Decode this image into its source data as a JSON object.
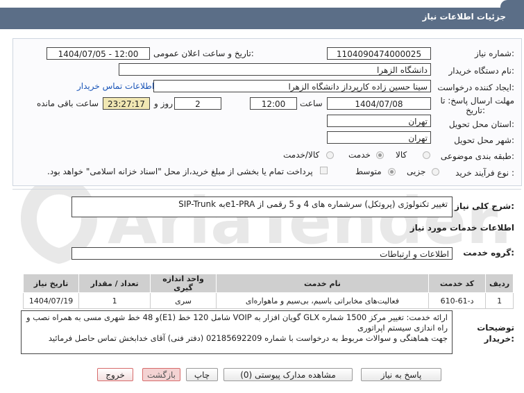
{
  "header": {
    "title": "جزئیات اطلاعات نیاز"
  },
  "watermark": {
    "text": "AriaTender.net"
  },
  "form": {
    "need_number": {
      "label": "شماره نیاز:",
      "value": "1104090474000025"
    },
    "announce_datetime": {
      "label": "تاریخ و ساعت اعلان عمومی:",
      "value": "1404/07/05 - 12:00"
    },
    "buyer_org": {
      "label": "نام دستگاه خریدار:",
      "value": "دانشگاه الزهرا"
    },
    "requester": {
      "label": "ایجاد کننده درخواست:",
      "value": "سینا حسین زاده کارپرداز دانشگاه الزهرا"
    },
    "buyer_contact_link": "اطلاعات تماس خریدار",
    "deadline": {
      "label_line1": "مهلت ارسال پاسخ: تا",
      "label_line2": "تاریخ:",
      "date": "1404/07/08",
      "time_label": "ساعت",
      "time": "12:00",
      "days": "2",
      "days_label": "روز و",
      "remaining": "23:27:17",
      "remaining_label": "ساعت باقی مانده"
    },
    "province": {
      "label": "استان محل تحویل:",
      "value": "تهران"
    },
    "city": {
      "label": "شهر محل تحویل:",
      "value": "تهران"
    },
    "category": {
      "label": "طبقه بندی موضوعی:",
      "options": [
        "کالا",
        "خدمت",
        "کالا/خدمت"
      ],
      "selected": "خدمت"
    },
    "purchase_type": {
      "label": "نوع فرآیند خرید :",
      "options": [
        "جزیی",
        "متوسط"
      ],
      "selected": "متوسط",
      "payment_note": "پرداخت تمام یا بخشی از مبلغ خرید،از محل \"اسناد خزانه اسلامی\" خواهد بود."
    }
  },
  "general_description": {
    "label": "شرح کلی نیاز:",
    "value": "تغییر تکنولوژی (پروتکل) سرشماره های 4 و 5 رقمی از e1-PRAبه SIP-Trunk"
  },
  "services_section": {
    "title": "اطلاعات خدمات مورد نیاز"
  },
  "service_group": {
    "label": "گروه خدمت:",
    "value": "اطلاعات و ارتباطات"
  },
  "table": {
    "headers": [
      "ردیف",
      "کد خدمت",
      "نام خدمت",
      "واحد اندازه گیری",
      "تعداد / مقدار",
      "تاریخ نیاز"
    ],
    "rows": [
      [
        "1",
        "د-61-610",
        "فعالیت‌های مخابراتی باسیم، بی‌سیم و ماهواره‌ای",
        "سری",
        "1",
        "1404/07/19"
      ]
    ]
  },
  "buyer_notes": {
    "label_line1": "توضیحات",
    "label_line2": "خریدار:",
    "lines": [
      "ارائه خدمت: تغییر مرکز 1500 شماره GLX گویان افزار به VOIP شامل 120 خط (E1)و 48 خط شهری مسی به همراه نصب و",
      "راه اندازی سیستم اپراتوری",
      "جهت هماهنگی و سوالات مربوط به درخواست با شماره 02185692209 (دفتر فنی) آقای خدابخش تماس حاصل فرمائید"
    ]
  },
  "buttons": {
    "reply": "پاسخ به نیاز",
    "attachments": "مشاهده مدارک پیوستی (0)",
    "print": "چاپ",
    "back": "بازگشت",
    "exit": "خروج"
  }
}
